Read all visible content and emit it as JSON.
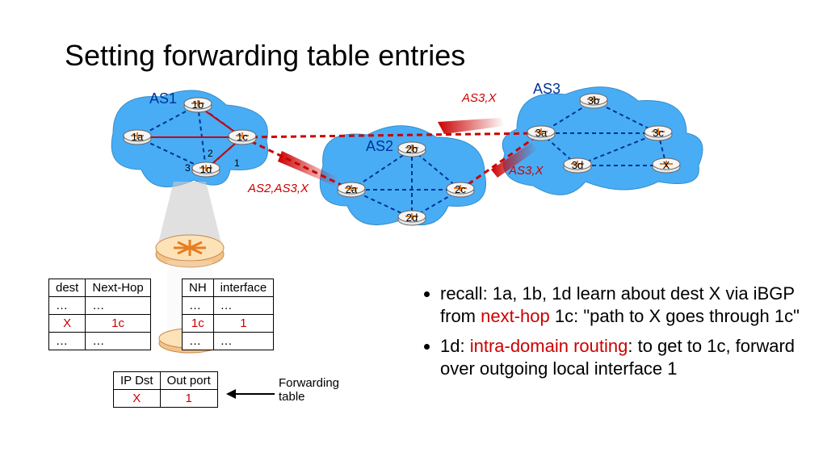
{
  "title": "Setting forwarding table entries",
  "as": {
    "as1": "AS1",
    "as2": "AS2",
    "as3": "AS3"
  },
  "routers": {
    "1a": "1a",
    "1b": "1b",
    "1c": "1c",
    "1d": "1d",
    "2a": "2a",
    "2b": "2b",
    "2c": "2c",
    "2d": "2d",
    "3a": "3a",
    "3b": "3b",
    "3c": "3c",
    "3d": "3d",
    "X": "X"
  },
  "paths": {
    "p1": "AS3,X",
    "p2": "AS3,X",
    "p3": "AS2,AS3,X"
  },
  "iface": {
    "n1": "1",
    "n2": "2",
    "n3": "3"
  },
  "tbl_dest": {
    "h1": "dest",
    "h2": "Next-Hop",
    "r1c1": "…",
    "r1c2": "…",
    "r2c1": "X",
    "r2c2": "1c",
    "r3c1": "…",
    "r3c2": "…"
  },
  "tbl_nh": {
    "h1": "NH",
    "h2": "interface",
    "r1c1": "…",
    "r1c2": "…",
    "r2c1": "1c",
    "r2c2": "1",
    "r3c1": "…",
    "r3c2": "…"
  },
  "tbl_fwd": {
    "h1": "IP Dst",
    "h2": "Out port",
    "r1c1": "X",
    "r1c2": "1"
  },
  "fwd_label1": "Forwarding",
  "fwd_label2": "table",
  "bullets": {
    "b1a": "recall: 1a, 1b, 1d learn about dest X via iBGP from ",
    "b1b": "next-hop",
    "b1c": " 1c: \"path to X goes through 1c\"",
    "b2a": "1d: ",
    "b2b": "intra-domain routing",
    "b2c": ": to get to 1c, forward over outgoing local interface 1"
  }
}
